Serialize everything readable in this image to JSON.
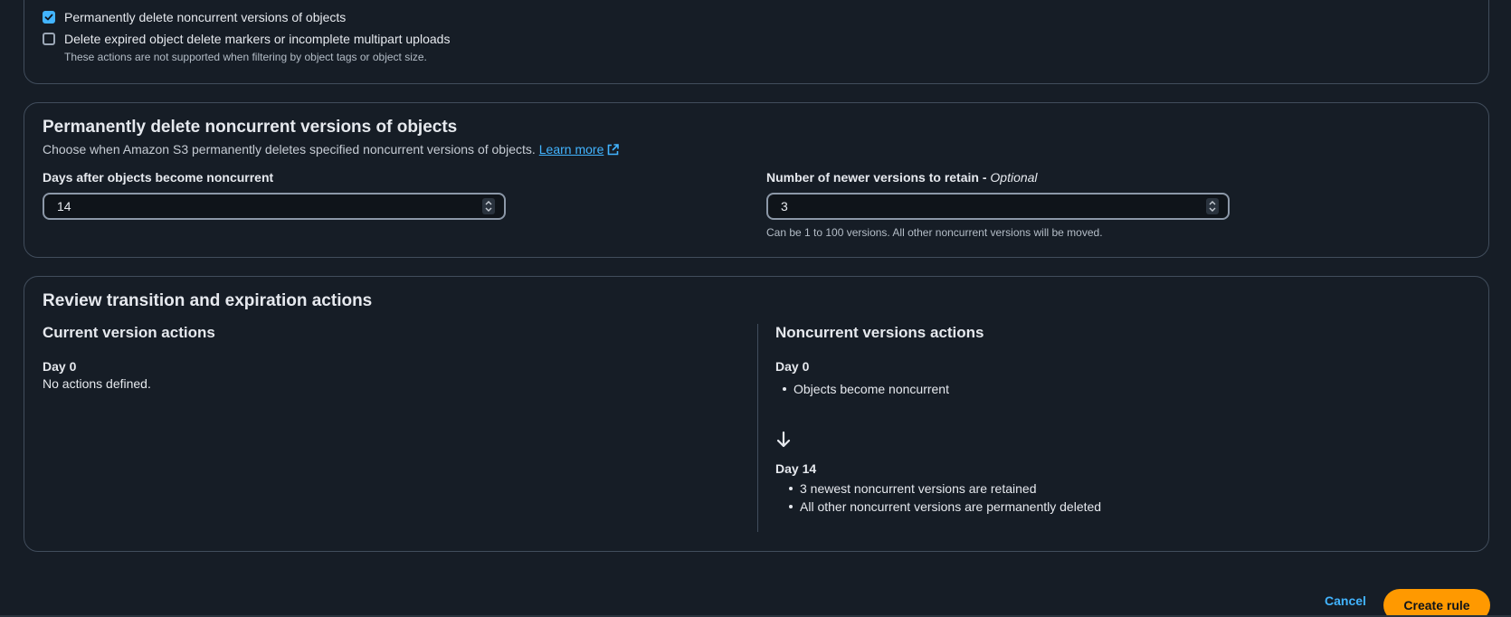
{
  "actions_card": {
    "options": [
      {
        "label": "Permanently delete noncurrent versions of objects",
        "checked": true
      },
      {
        "label": "Delete expired object delete markers or incomplete multipart uploads",
        "checked": false
      }
    ],
    "hint": "These actions are not supported when filtering by object tags or object size."
  },
  "noncurrent_card": {
    "title": "Permanently delete noncurrent versions of objects",
    "description": "Choose when Amazon S3 permanently deletes specified noncurrent versions of objects.",
    "learn_more": "Learn more",
    "days_field": {
      "label": "Days after objects become noncurrent",
      "value": "14"
    },
    "versions_field": {
      "label": "Number of newer versions to retain - ",
      "label_optional": "Optional",
      "value": "3",
      "hint": "Can be 1 to 100 versions. All other noncurrent versions will be moved."
    }
  },
  "review_card": {
    "title": "Review transition and expiration actions",
    "current": {
      "title": "Current version actions",
      "day": "Day 0",
      "text": "No actions defined."
    },
    "noncurrent": {
      "title": "Noncurrent versions actions",
      "day0": "Day 0",
      "day0_items": [
        "Objects become noncurrent"
      ],
      "day14": "Day 14",
      "day14_items": [
        "3 newest noncurrent versions are retained",
        "All other noncurrent versions are permanently deleted"
      ]
    }
  },
  "footer": {
    "cancel_label": "Cancel",
    "create_label": "Create rule"
  },
  "colors": {
    "background": "#161d26",
    "accent": "#42b4ff",
    "primary_button": "#ff9900",
    "border": "#414d5c"
  }
}
